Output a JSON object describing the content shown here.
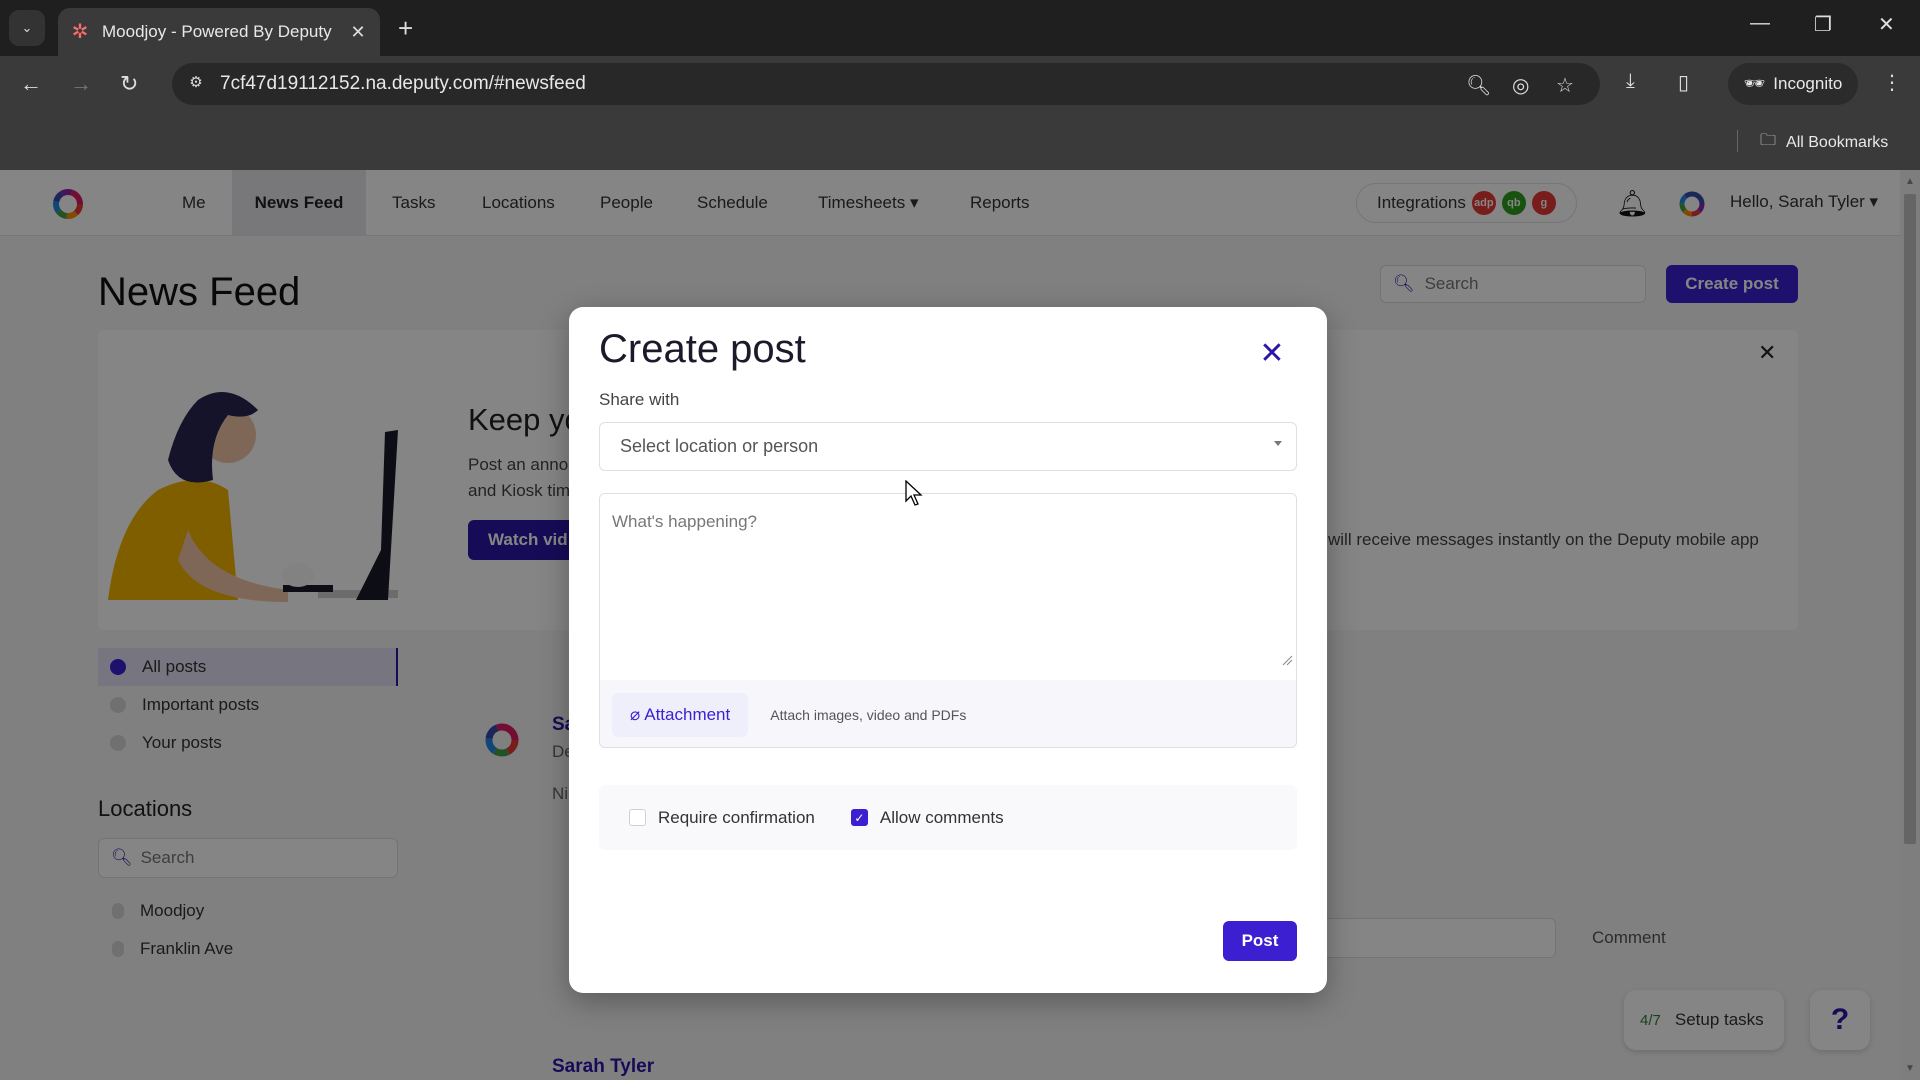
{
  "browser": {
    "tab_title": "Moodjoy - Powered By Deputy",
    "url": "7cf47d19112152.na.deputy.com/#newsfeed",
    "incognito_label": "Incognito",
    "bookmarks_label": "All Bookmarks"
  },
  "topnav": {
    "items": [
      {
        "label": "Me"
      },
      {
        "label": "News Feed",
        "active": true
      },
      {
        "label": "Tasks"
      },
      {
        "label": "Locations"
      },
      {
        "label": "People"
      },
      {
        "label": "Schedule"
      },
      {
        "label": "Timesheets ▾"
      },
      {
        "label": "Reports"
      }
    ],
    "integrations_label": "Integrations",
    "integration_badges": [
      "adp",
      "qb",
      "g"
    ],
    "greeting": "Hello, Sarah Tyler ▾"
  },
  "page": {
    "title": "News Feed",
    "search_placeholder": "Search",
    "create_post_label": "Create post",
    "banner": {
      "title": "Keep yo",
      "text_line1": "Post an anno",
      "text_line2": "and Kiosk tim",
      "text_right": "will receive messages instantly on the Deputy mobile app",
      "button_label": "Watch vid"
    },
    "filters": [
      {
        "label": "All posts",
        "active": true
      },
      {
        "label": "Important posts"
      },
      {
        "label": "Your posts"
      }
    ],
    "locations_title": "Locations",
    "locations_search_placeholder": "Search",
    "locations": [
      "Moodjoy",
      "Franklin Ave"
    ],
    "feed": {
      "post1_name": "Sa",
      "post1_sub": "De",
      "post1_body": "Ni",
      "comment_label": "Comment",
      "post2_name": "Sarah Tyler"
    },
    "setup_count": "4/7",
    "setup_label": "Setup tasks",
    "help_label": "?"
  },
  "modal": {
    "title": "Create post",
    "share_label": "Share with",
    "share_placeholder": "Select location or person",
    "compose_placeholder": "What's happening?",
    "attachment_label": "Attachment",
    "attachment_hint": "Attach images, video and PDFs",
    "require_confirmation_label": "Require confirmation",
    "require_confirmation_checked": false,
    "allow_comments_label": "Allow comments",
    "allow_comments_checked": true,
    "post_label": "Post"
  },
  "colors": {
    "accent": "#3b1fd1",
    "dark_accent": "#2b16a8",
    "overlay": "rgba(0,0,0,0.48)"
  }
}
